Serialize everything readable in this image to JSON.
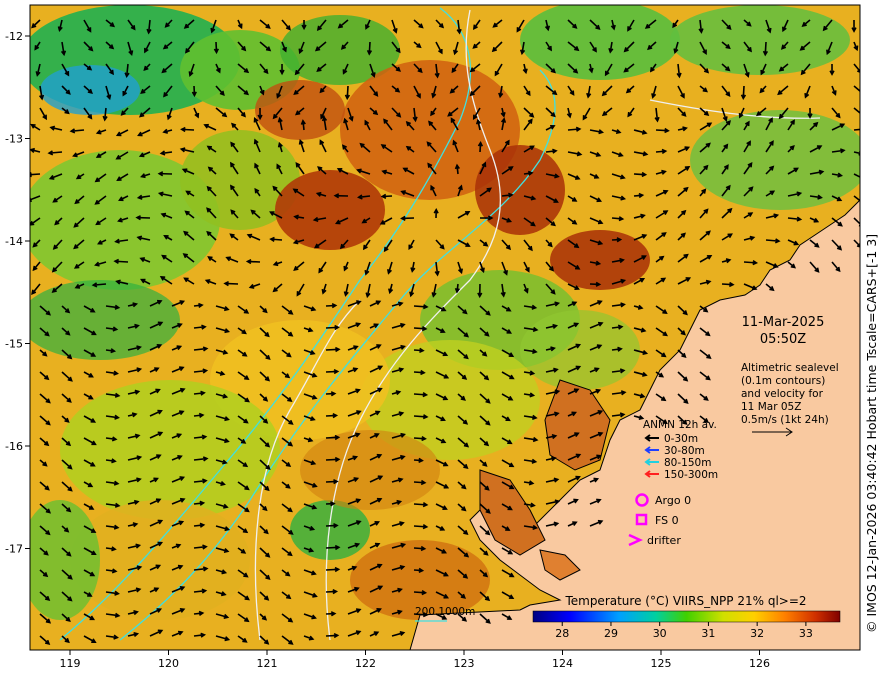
{
  "timestamp": {
    "date": "11-Mar-2025",
    "time": "05:50Z"
  },
  "description_lines": [
    "Altimetric sealevel",
    "(0.1m contours)",
    "and velocity for",
    "11 Mar 05Z",
    "0.5m/s (1kt 24h)"
  ],
  "anmn_legend": {
    "title": "ANMN 12h av.",
    "items": [
      {
        "label": "0-30m",
        "color": "#000000"
      },
      {
        "label": "30-80m",
        "color": "#2040ff"
      },
      {
        "label": "80-150m",
        "color": "#20d0e0"
      },
      {
        "label": "150-300m",
        "color": "#ff2020"
      }
    ]
  },
  "obs_legend": [
    {
      "label": "Argo 0",
      "symbol": "circle",
      "color": "#ff00ff"
    },
    {
      "label": "FS 0",
      "symbol": "square",
      "color": "#ff00ff"
    },
    {
      "label": "drifter",
      "symbol": "chevron",
      "color": "#ff00ff"
    }
  ],
  "contour_legend": {
    "label": "200  1000m",
    "color": "#40e0e0"
  },
  "colorbar": {
    "title": "Temperature (°C) VIIRS_NPP 21% ql>=2",
    "ticks": [
      "28",
      "29",
      "30",
      "31",
      "32",
      "33"
    ],
    "range": [
      27.4,
      33.7
    ]
  },
  "x_axis": {
    "ticks": [
      "119",
      "120",
      "121",
      "122",
      "123",
      "124",
      "125",
      "126"
    ]
  },
  "y_axis": {
    "ticks": [
      "-12",
      "-13",
      "-14",
      "-15",
      "-16",
      "-17"
    ]
  },
  "credit": "© IMOS 12-Jan-2026 03:40:42 Hobart time Tscale=CARS+[-1 3]",
  "colors": {
    "land": "#f9c9a0",
    "warm": "#c85000",
    "cool": "#22aa22",
    "contour": "#40e0e0"
  }
}
